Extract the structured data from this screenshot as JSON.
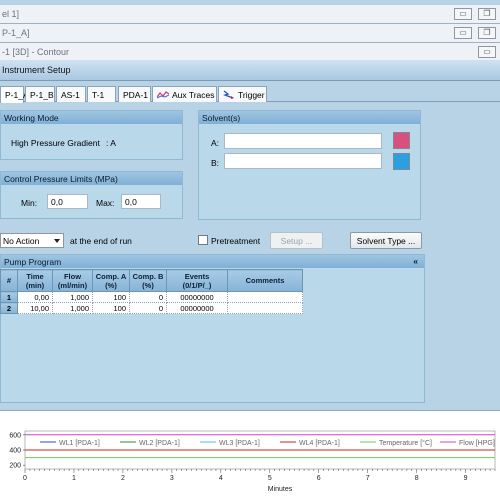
{
  "windows": {
    "w1_title": "el 1]",
    "w2_title": "P-1_A]",
    "w3_title": "-1 [3D] - Contour"
  },
  "dialog": {
    "title": "Instrument Setup"
  },
  "tabs": [
    {
      "label": "P-1_A",
      "active": true
    },
    {
      "label": "P-1_B"
    },
    {
      "label": "AS-1"
    },
    {
      "label": "T-1"
    },
    {
      "label": "PDA-1"
    },
    {
      "label": "Aux Traces",
      "icon": "aux-traces-icon"
    },
    {
      "label": "Trigger",
      "icon": "trigger-icon"
    }
  ],
  "working_mode": {
    "header": "Working Mode",
    "label": "High Pressure Gradient",
    "value": ": A"
  },
  "pressure": {
    "header": "Control Pressure Limits (MPa)",
    "min_label": "Min:",
    "min_value": "0,0",
    "max_label": "Max:",
    "max_value": "0,0"
  },
  "solvents": {
    "header": "Solvent(s)",
    "a_label": "A:",
    "a_value": "",
    "a_color": "#d9507e",
    "b_label": "B:",
    "b_value": "",
    "b_color": "#2b9fe0"
  },
  "action": {
    "select_value": "No Action",
    "suffix": "at the end of run",
    "pretreatment_label": "Pretreatment",
    "pretreatment_checked": false,
    "setup_label": "Setup ...",
    "solvent_type_label": "Solvent Type ..."
  },
  "pump_program": {
    "header": "Pump Program",
    "collapse_glyph": "«",
    "columns": [
      "#",
      "Time\n(min)",
      "Flow\n(ml/min)",
      "Comp. A\n(%)",
      "Comp. B\n(%)",
      "Events\n(0/1/P/_)",
      "Comments"
    ],
    "rows": [
      {
        "n": "1",
        "time": "0,00",
        "flow": "1,000",
        "a": "100",
        "b": "0",
        "events": "00000000",
        "comments": ""
      },
      {
        "n": "2",
        "time": "10,00",
        "flow": "1,000",
        "a": "100",
        "b": "0",
        "events": "00000000",
        "comments": ""
      }
    ]
  },
  "chart_data": {
    "type": "line",
    "xlabel": "Minutes",
    "ylabel": "",
    "xlim": [
      0,
      9.6
    ],
    "ylim": [
      150,
      650
    ],
    "x_ticks": [
      "0",
      "1",
      "2",
      "3",
      "4",
      "5",
      "6",
      "7",
      "8",
      "9"
    ],
    "y_ticks": [
      "200",
      "400",
      "600"
    ],
    "legend": [
      {
        "name": "WL1 [PDA-1]",
        "color": "#3344dd"
      },
      {
        "name": "WL2 [PDA-1]",
        "color": "#2e8b3a"
      },
      {
        "name": "WL3 [PDA-1]",
        "color": "#38c8e6"
      },
      {
        "name": "WL4 [PDA-1]",
        "color": "#cc2222"
      },
      {
        "name": "Temperature [°C]",
        "color": "#66cc55"
      },
      {
        "name": "Flow [HPG]",
        "color": "#cc44cc"
      }
    ],
    "series": [
      {
        "name": "WL4 [PDA-1]",
        "color": "#cc2222",
        "x": [
          0,
          9.6
        ],
        "y": [
          400,
          400
        ]
      },
      {
        "name": "Temperature [°C]",
        "color": "#66cc55",
        "x": [
          0,
          9.6
        ],
        "y": [
          300,
          300
        ]
      },
      {
        "name": "Flow [HPG]",
        "color": "#cc44cc",
        "x": [
          0,
          9.6
        ],
        "y": [
          600,
          600
        ]
      }
    ]
  }
}
